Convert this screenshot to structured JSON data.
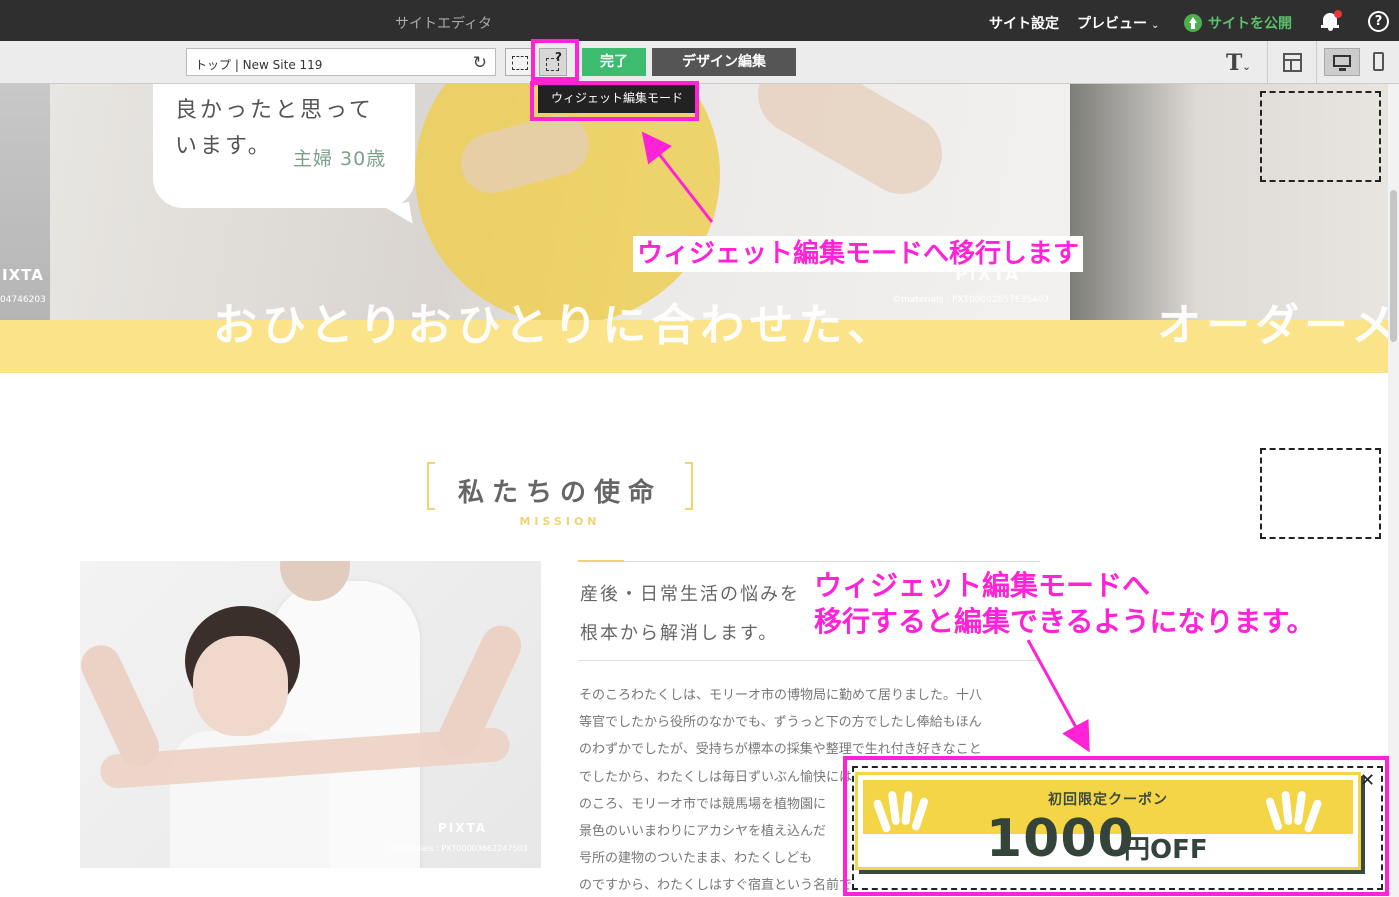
{
  "topbar": {
    "title": "サイトエディタ",
    "site_settings": "サイト設定",
    "preview": "プレビュー",
    "publish": "サイトを公開",
    "help": "?"
  },
  "toolbar": {
    "url_value": "トップ | New Site 119",
    "done": "完了",
    "design_edit": "デザイン編集",
    "text_tool": "T",
    "widget_mode_tooltip": "ウィジェット編集モード"
  },
  "hero": {
    "speech_line1": "良かったと思って",
    "speech_line2": "います。",
    "speech_who": "主婦 30歳",
    "pixta_left": "IXTA",
    "pixta_left_id": "04746203",
    "pixta_main": "PIXTA",
    "pixta_main_id": "©materials : PXT00002857635403",
    "headline_1": "おひとりおひとりに合わせた、",
    "headline_2": "オーダーメ"
  },
  "mission": {
    "title": "私たちの使命",
    "subtitle": "MISSION",
    "photo_pixta": "PIXTA",
    "photo_id": "©materials : PXT00003662247503",
    "lead_1": "産後・日常生活の悩みを",
    "lead_2": "根本から解消します。",
    "body_lines": [
      "そのころわたくしは、モリーオ市の博物局に勤めて居りました。十八",
      "等官でしたから役所のなかでも、ずうっと下の方でしたし俸給もほん",
      "のわずかでしたが、受持ちが標本の採集や整理で生れ付き好きなこと",
      "でしたから、わたくしは毎日ずいぶん愉快にはたらきました。殊にそ",
      "のころ、モリーオ市では競馬場を植物園に",
      "景色のいいまわりにアカシヤを植え込んだ",
      "号所の建物のついたまま、わたくしども",
      "のですから、わたくしはすぐ宿直という名前で月賦で買った小さな蓄"
    ]
  },
  "coupon": {
    "title": "初回限定クーポン",
    "amount": "1000",
    "unit": "円OFF",
    "close": "✕"
  },
  "annotations": {
    "note_1": "ウィジェット編集モードへ移行します",
    "note_2_line1": "ウィジェット編集モードへ",
    "note_2_line2": "移行すると編集できるようになります。",
    "color": "#ff22d6"
  },
  "colors": {
    "accent_yellow": "#f4d545",
    "done_green": "#3dbb6f",
    "topbar": "#2f2f2f"
  }
}
